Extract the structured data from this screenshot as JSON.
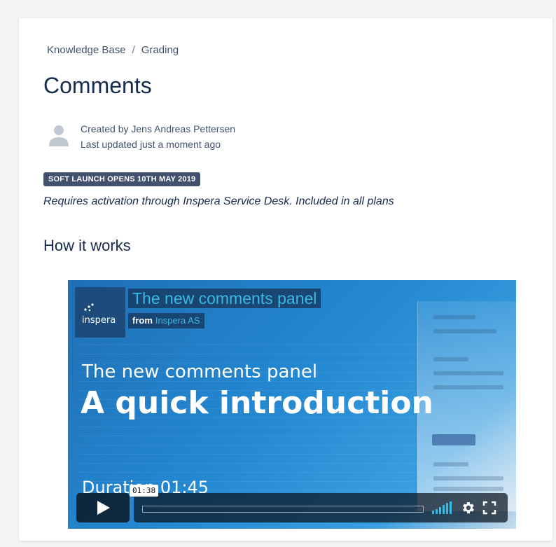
{
  "breadcrumb": {
    "items": [
      "Knowledge Base",
      "Grading"
    ],
    "separator": "/"
  },
  "page": {
    "title": "Comments",
    "created_by_prefix": "Created by",
    "author": "Jens Andreas Pettersen",
    "last_updated": "Last updated just a moment ago",
    "badge": "SOFT LAUNCH OPENS 10TH MAY 2019",
    "note": "Requires activation through Inspera Service Desk. Included in all plans",
    "section_heading": "How it works"
  },
  "video": {
    "logo_text": "inspera",
    "title": "The new comments panel",
    "from_label": "from",
    "from_author": "Inspera AS",
    "headline": "The new comments  panel",
    "big_headline": "A quick introduction",
    "duration_text": "Duration 01:45",
    "current_time": "01:38",
    "progress_fraction": 0.0,
    "colors": {
      "accent": "#39b9e6",
      "background": "#2387d0",
      "title_bg": "#1d4c7c"
    },
    "icons": [
      "play-icon",
      "volume-icon",
      "gear-icon",
      "fullscreen-icon"
    ]
  },
  "colors": {
    "badge_bg": "#42526e",
    "heading_text": "#172b4d",
    "secondary_text": "#42526e"
  }
}
